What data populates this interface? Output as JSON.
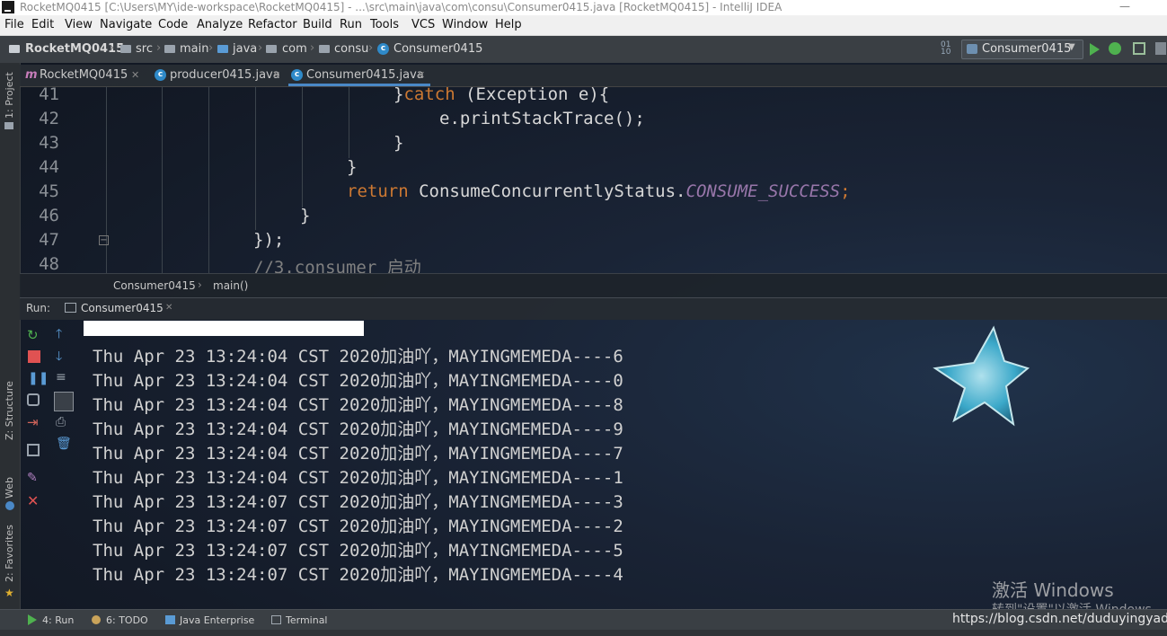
{
  "window": {
    "title": "RocketMQ0415 [C:\\Users\\MY\\ide-workspace\\RocketMQ0415] - ...\\src\\main\\java\\com\\consu\\Consumer0415.java [RocketMQ0415] - IntelliJ IDEA"
  },
  "menu": [
    "File",
    "Edit",
    "View",
    "Navigate",
    "Code",
    "Analyze",
    "Refactor",
    "Build",
    "Run",
    "Tools",
    "VCS",
    "Window",
    "Help"
  ],
  "breadcrumbs": [
    "RocketMQ0415",
    "src",
    "main",
    "java",
    "com",
    "consu",
    "Consumer0415"
  ],
  "run_config": {
    "label": "Consumer0415"
  },
  "tabs": [
    {
      "label": "RocketMQ0415",
      "icon": "m-module-icon"
    },
    {
      "label": "producer0415.java",
      "icon": "class-icon"
    },
    {
      "label": "Consumer0415.java",
      "icon": "class-icon",
      "active": true
    }
  ],
  "left_strip": {
    "project": "1: Project",
    "structure": "Z: Structure",
    "web": "Web",
    "favorites": "2: Favorites"
  },
  "editor": {
    "lines": [
      {
        "num": "41",
        "pre": "}",
        "kw": "catch",
        "post": " (Exception e){"
      },
      {
        "num": "42",
        "text": "e.printStackTrace();"
      },
      {
        "num": "43",
        "text": "}"
      },
      {
        "num": "44",
        "text": "}"
      },
      {
        "num": "45",
        "kw": "return",
        "mid": " ConsumeConcurrentlyStatus.",
        "const": "CONSUME_SUCCESS",
        "post": ";"
      },
      {
        "num": "46",
        "text": "}"
      },
      {
        "num": "47",
        "text": "});"
      },
      {
        "num": "48",
        "comment": "//3.consumer 启动"
      }
    ],
    "crumbs": [
      "Consumer0415",
      "main()"
    ]
  },
  "run_panel": {
    "label": "Run:",
    "tab": "Consumer0415",
    "output": [
      "Thu Apr 23 13:24:04 CST 2020加油吖，MAYINGMEMEDA----6",
      "Thu Apr 23 13:24:04 CST 2020加油吖，MAYINGMEMEDA----0",
      "Thu Apr 23 13:24:04 CST 2020加油吖，MAYINGMEMEDA----8",
      "Thu Apr 23 13:24:04 CST 2020加油吖，MAYINGMEMEDA----9",
      "Thu Apr 23 13:24:04 CST 2020加油吖，MAYINGMEMEDA----7",
      "Thu Apr 23 13:24:04 CST 2020加油吖，MAYINGMEMEDA----1",
      "Thu Apr 23 13:24:07 CST 2020加油吖，MAYINGMEMEDA----3",
      "Thu Apr 23 13:24:07 CST 2020加油吖，MAYINGMEMEDA----2",
      "Thu Apr 23 13:24:07 CST 2020加油吖，MAYINGMEMEDA----5",
      "Thu Apr 23 13:24:07 CST 2020加油吖，MAYINGMEMEDA----4"
    ]
  },
  "bottom_tools": [
    {
      "label": "4: Run"
    },
    {
      "label": "6: TODO"
    },
    {
      "label": "Java Enterprise"
    },
    {
      "label": "Terminal"
    }
  ],
  "watermark": {
    "line1": "激活 Windows",
    "line2": "转到\"设置\"以激活 Windows。"
  },
  "csdn_url": "https://blog.csdn.net/duduyingyad",
  "colors": {
    "keyword": "#cc7832",
    "constant": "#9876aa",
    "run_green": "#4fb14f",
    "stop_red": "#e05252",
    "accent": "#4a88c7"
  }
}
